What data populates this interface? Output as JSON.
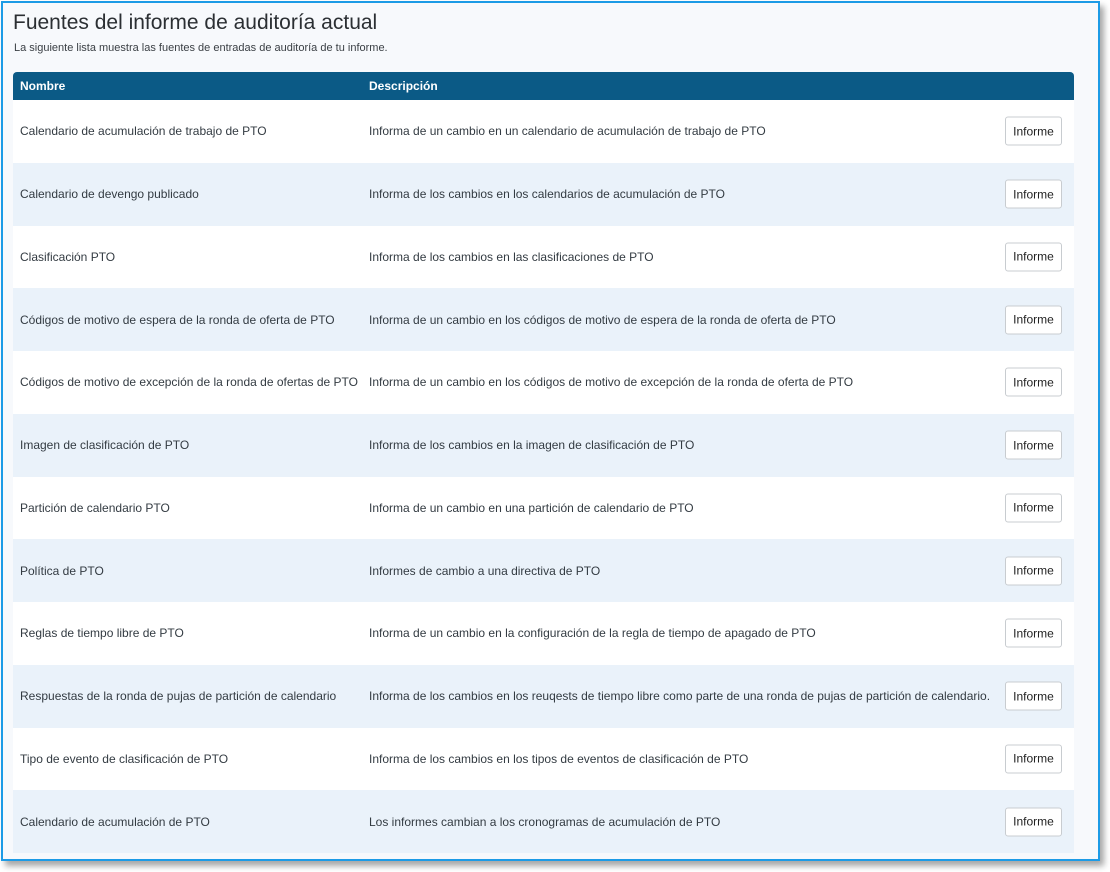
{
  "header": {
    "title": "Fuentes del informe de auditoría actual",
    "subtitle": "La siguiente lista muestra las fuentes de entradas de auditoría de tu informe."
  },
  "table": {
    "columns": [
      "Nombre",
      "Descripción"
    ],
    "button_label": "Informe",
    "rows": [
      {
        "name": "Calendario de acumulación de trabajo de PTO",
        "description": "Informa de un cambio en un calendario de acumulación de trabajo de PTO"
      },
      {
        "name": "Calendario de devengo publicado",
        "description": "Informa de los cambios en los calendarios de acumulación de PTO"
      },
      {
        "name": "Clasificación PTO",
        "description": "Informa de los cambios en las clasificaciones de PTO"
      },
      {
        "name": "Códigos de motivo de espera de la ronda de oferta de PTO",
        "description": "Informa de un cambio en los códigos de motivo de espera de la ronda de oferta de PTO"
      },
      {
        "name": "Códigos de motivo de excepción de la ronda de ofertas de PTO",
        "description": "Informa de un cambio en los códigos de motivo de excepción de la ronda de oferta de PTO"
      },
      {
        "name": "Imagen de clasificación de PTO",
        "description": "Informa de los cambios en la imagen de clasificación de PTO"
      },
      {
        "name": "Partición de calendario PTO",
        "description": "Informa de un cambio en una partición de calendario de PTO"
      },
      {
        "name": "Política de PTO",
        "description": "Informes de cambio a una directiva de PTO"
      },
      {
        "name": "Reglas de tiempo libre de PTO",
        "description": "Informa de un cambio en la configuración de la regla de tiempo de apagado de PTO"
      },
      {
        "name": "Respuestas de la ronda de pujas de partición de calendario",
        "description": "Informa de los cambios en los reuqests de tiempo libre como parte de una ronda de pujas de partición de calendario."
      },
      {
        "name": "Tipo de evento de clasificación de PTO",
        "description": "Informa de los cambios en los tipos de eventos de clasificación de PTO"
      },
      {
        "name": "Calendario de acumulación de PTO",
        "description": "Los informes cambian a los cronogramas de acumulación de PTO"
      }
    ]
  }
}
